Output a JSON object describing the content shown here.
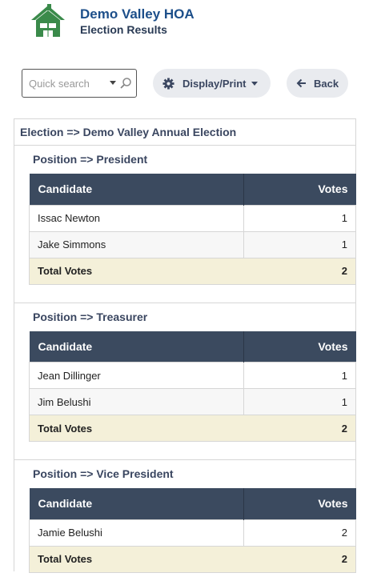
{
  "header": {
    "org_name": "Demo Valley HOA",
    "subtitle": "Election Results",
    "logo_icon": "house-logo-icon",
    "brand_color": "#3a8a4a"
  },
  "toolbar": {
    "search_placeholder": "Quick search",
    "display_print_label": "Display/Print",
    "back_label": "Back"
  },
  "election": {
    "title": "Election => Demo Valley Annual Election"
  },
  "table_headers": {
    "candidate": "Candidate",
    "votes": "Votes"
  },
  "total_label": "Total Votes",
  "positions": [
    {
      "title": "Position => President",
      "candidates": [
        {
          "name": "Issac Newton",
          "votes": "1"
        },
        {
          "name": "Jake Simmons",
          "votes": "1"
        }
      ],
      "total": "2"
    },
    {
      "title": "Position => Treasurer",
      "candidates": [
        {
          "name": "Jean Dillinger",
          "votes": "1"
        },
        {
          "name": "Jim Belushi",
          "votes": "1"
        }
      ],
      "total": "2"
    },
    {
      "title": "Position => Vice President",
      "candidates": [
        {
          "name": "Jamie Belushi",
          "votes": "2"
        }
      ],
      "total": "2"
    }
  ]
}
